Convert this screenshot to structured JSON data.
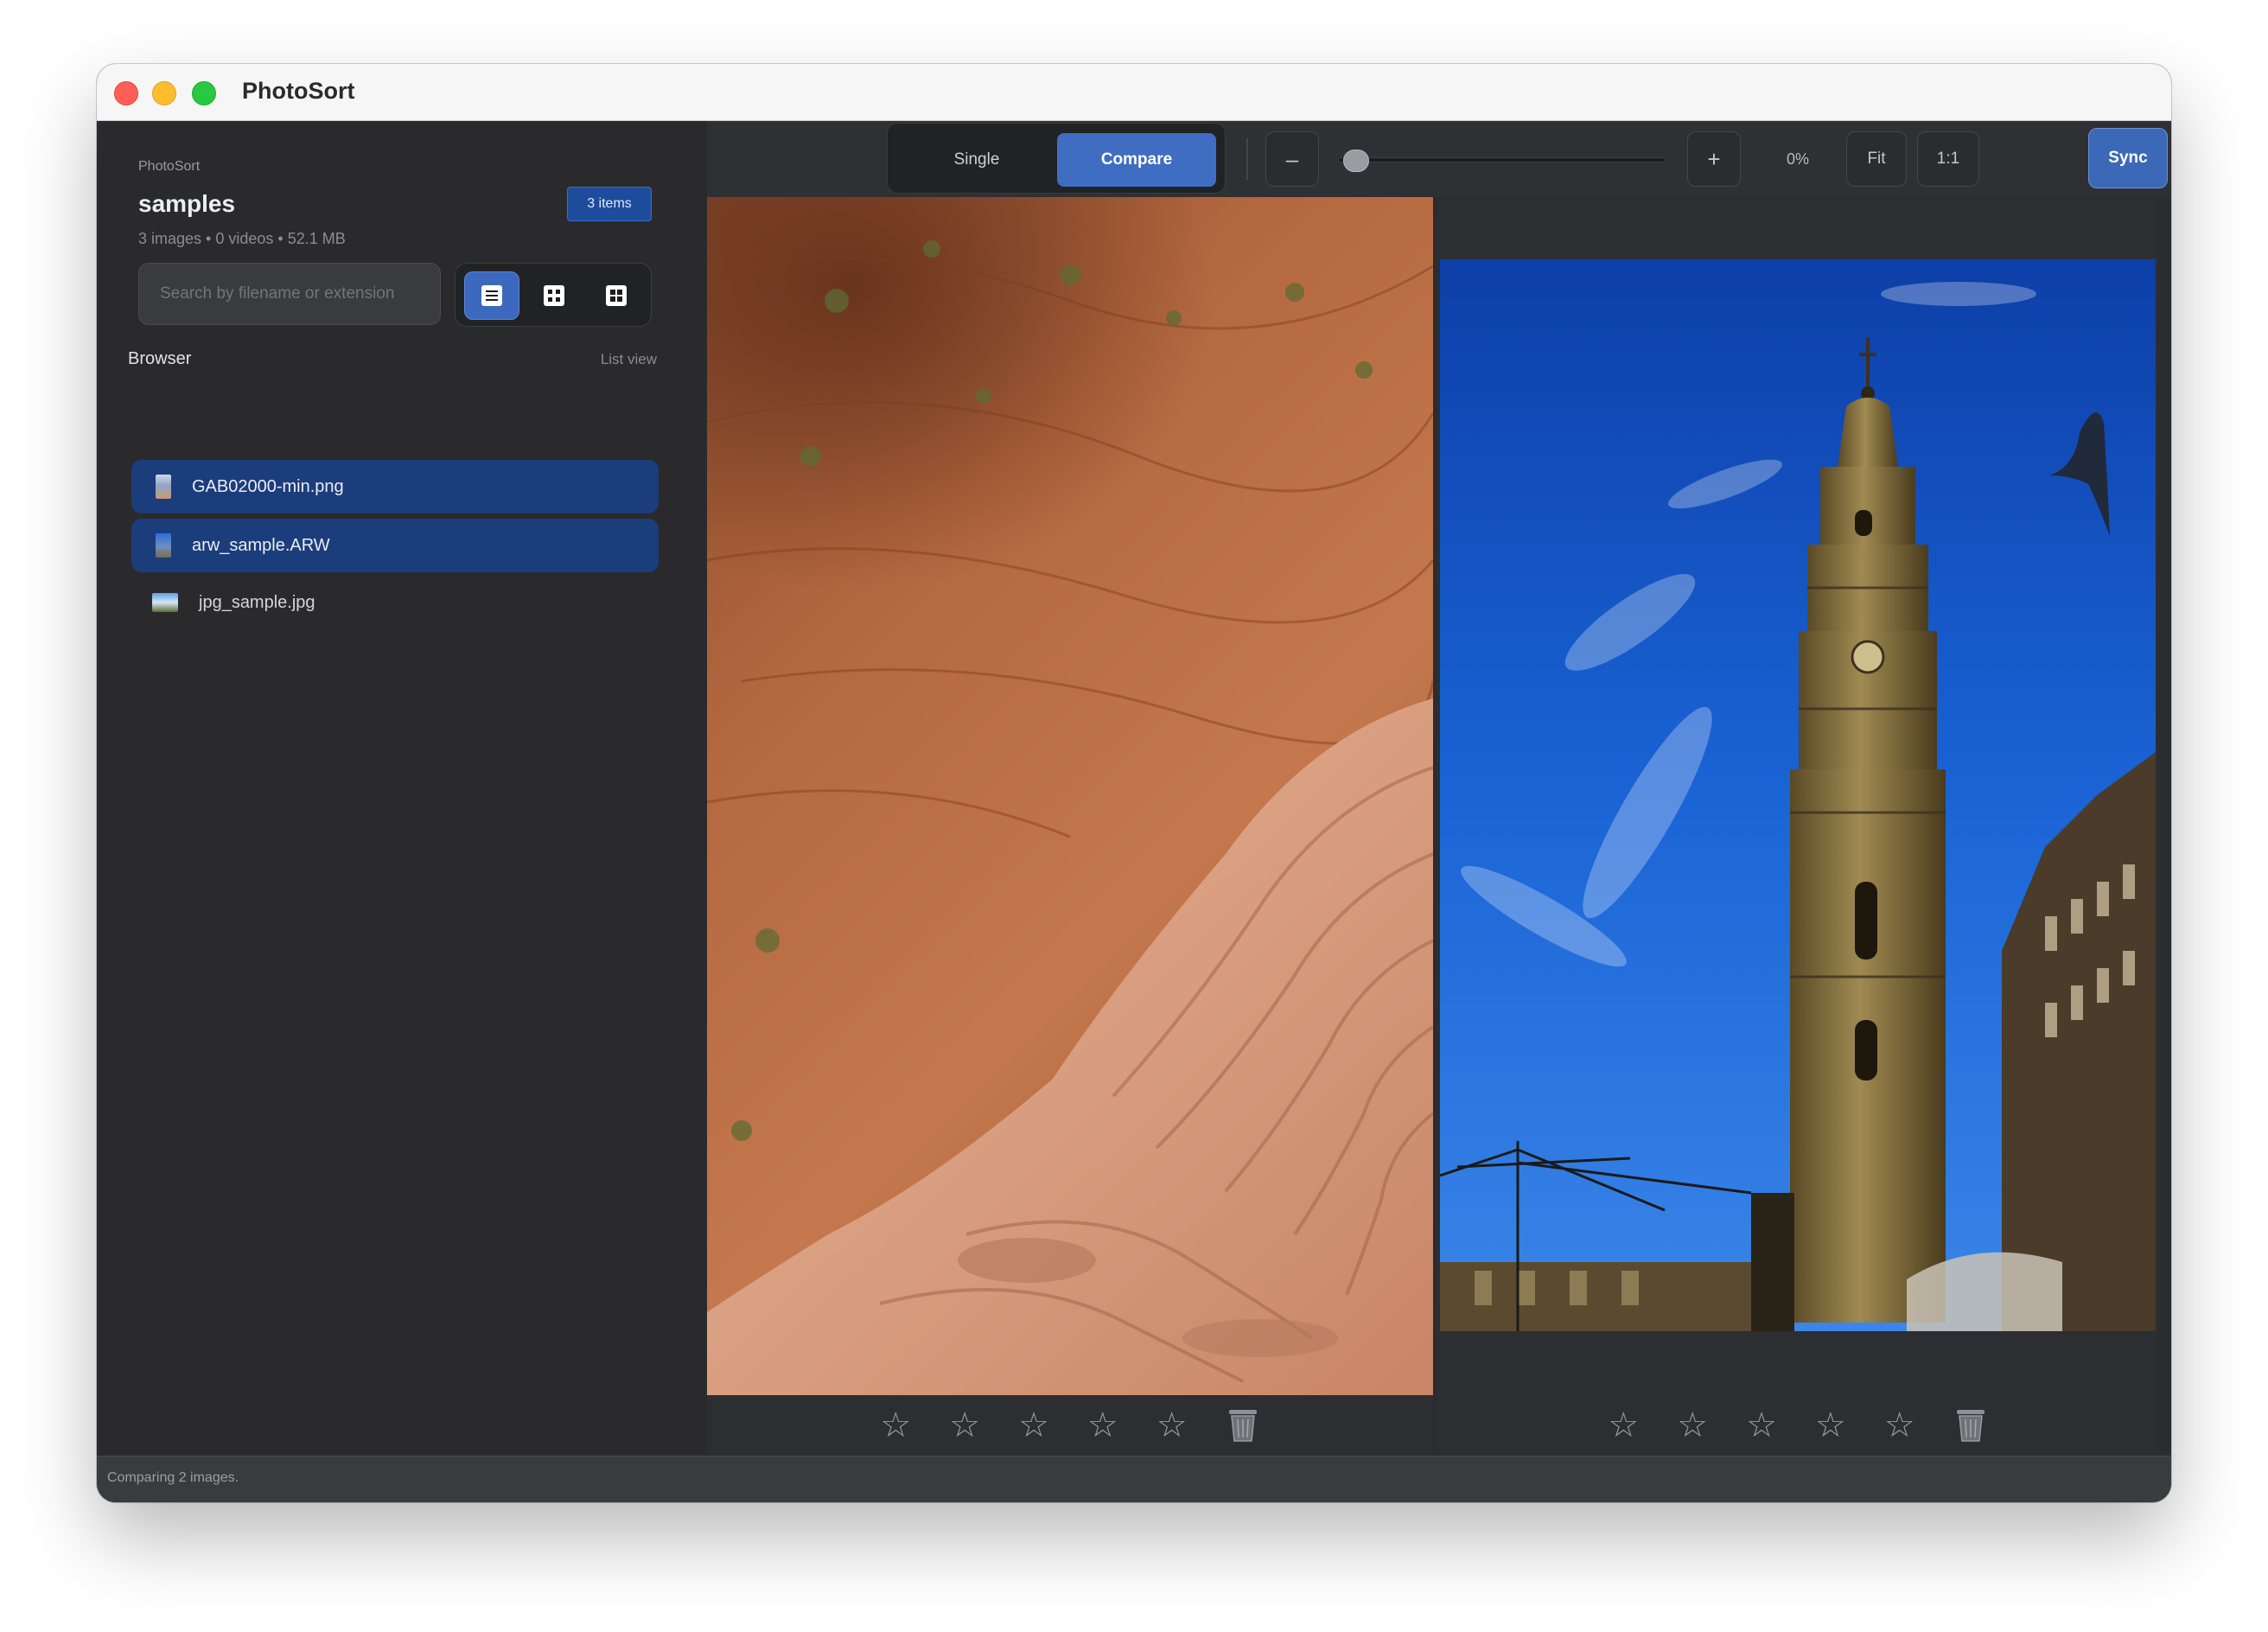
{
  "window": {
    "title": "PhotoSort"
  },
  "sidebar": {
    "app_label": "PhotoSort",
    "folder_name": "samples",
    "item_count_badge": "3 items",
    "meta": "3 images • 0 videos • 52.1 MB",
    "search": {
      "placeholder": "Search by filename or extension",
      "value": ""
    },
    "view_modes": [
      {
        "icon": "list-icon",
        "active": true
      },
      {
        "icon": "grid-icon",
        "active": false
      },
      {
        "icon": "grid-large-icon",
        "active": false
      }
    ],
    "section_title": "Browser",
    "view_label": "List view",
    "files": [
      {
        "name": "GAB02000-min.png",
        "selected": true
      },
      {
        "name": "arw_sample.ARW",
        "selected": true
      },
      {
        "name": "jpg_sample.jpg",
        "selected": false
      }
    ]
  },
  "toolbar": {
    "modes": [
      "Single",
      "Compare"
    ],
    "active_mode": "Compare",
    "zoom_out": "–",
    "zoom_in": "+",
    "zoom_percent": "0%",
    "zoom_level": 0,
    "fit_label": "Fit",
    "actual_size_label": "1:1",
    "sync_label": "Sync"
  },
  "panes": [
    {
      "image_icon": "sandstone-rock-image",
      "rating": 0,
      "star": "☆"
    },
    {
      "image_icon": "clock-tower-image",
      "rating": 0,
      "star": "☆"
    }
  ],
  "status": {
    "text": "Comparing 2 images."
  },
  "colors": {
    "accent": "#3f6dc1",
    "selection": "#1b3d7c",
    "background": "#2a2a2c"
  }
}
